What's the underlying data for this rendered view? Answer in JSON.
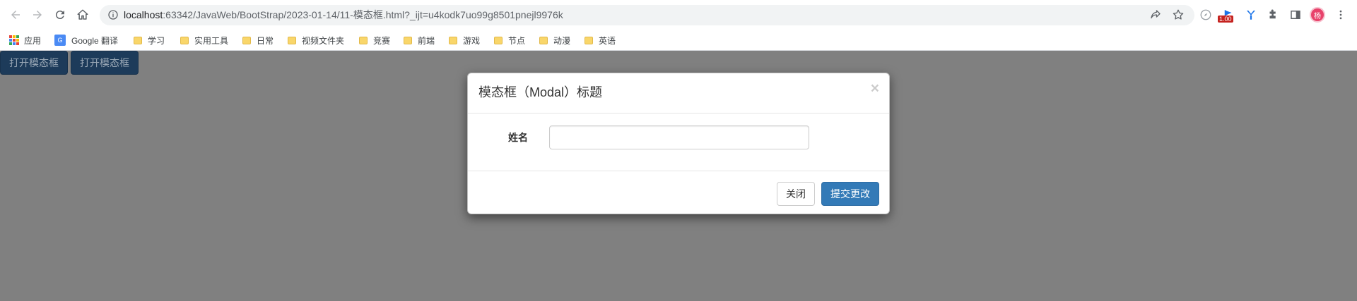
{
  "browser": {
    "url_host": "localhost",
    "url_rest": ":63342/JavaWeb/BootStrap/2023-01-14/11-模态框.html?_ijt=u4kodk7uo99g8501pnejl9976k",
    "extension_badge": "1.00",
    "avatar_text": "杨"
  },
  "bookmarks": [
    {
      "label": "应用",
      "icon": "apps-icon"
    },
    {
      "label": "Google 翻译",
      "icon": "google-translate-icon"
    },
    {
      "label": "学习",
      "icon": "folder-icon"
    },
    {
      "label": "实用工具",
      "icon": "folder-icon"
    },
    {
      "label": "日常",
      "icon": "folder-icon"
    },
    {
      "label": "视频文件夹",
      "icon": "folder-icon"
    },
    {
      "label": "竞赛",
      "icon": "folder-icon"
    },
    {
      "label": "前端",
      "icon": "folder-icon"
    },
    {
      "label": "游戏",
      "icon": "folder-icon"
    },
    {
      "label": "节点",
      "icon": "folder-icon"
    },
    {
      "label": "动漫",
      "icon": "folder-icon"
    },
    {
      "label": "英语",
      "icon": "folder-icon"
    }
  ],
  "page": {
    "open_buttons": [
      "打开模态框",
      "打开模态框"
    ]
  },
  "modal": {
    "title": "模态框（Modal）标题",
    "close_symbol": "×",
    "name_label": "姓名",
    "name_value": "",
    "close_button": "关闭",
    "submit_button": "提交更改"
  },
  "colors": {
    "primary": "#337ab7",
    "backdrop": "#808080"
  }
}
